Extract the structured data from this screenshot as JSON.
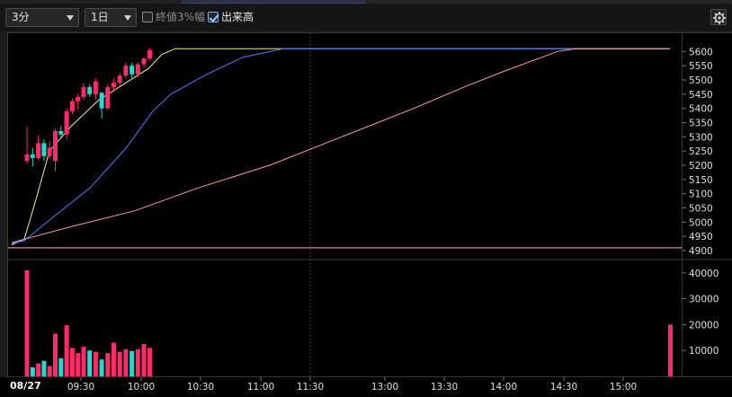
{
  "toolbar": {
    "interval_select": "3分",
    "period_select": "1日",
    "closing_range_label": "終値3%幅",
    "closing_range_checked": false,
    "volume_label": "出来高",
    "volume_checked": true,
    "settings_icon": "gear-icon"
  },
  "chart": {
    "date_label": "08/27",
    "time_ticks": [
      "09:30",
      "10:00",
      "10:30",
      "11:00",
      "11:30",
      "13:00",
      "13:30",
      "14:00",
      "14:30",
      "15:00"
    ],
    "price_ticks": [
      "5600",
      "5550",
      "5500",
      "5450",
      "5400",
      "5350",
      "5300",
      "5250",
      "5200",
      "5150",
      "5100",
      "5050",
      "5000",
      "4950",
      "4900"
    ],
    "volume_ticks": [
      "40000",
      "30000",
      "20000",
      "10000"
    ],
    "colors": {
      "up_candle": "#ff2a6a",
      "down_candle": "#22d8d0",
      "ma_short": "#f4f08a",
      "ma_mid": "#4f7cff",
      "ma_long": "#ff9aa8",
      "reference_line": "#ffb0b0"
    }
  },
  "chart_data": {
    "type": "candlestick",
    "candles": [
      {
        "time": "09:00",
        "open": 5215,
        "high": 5335,
        "low": 5205,
        "close": 5238
      },
      {
        "time": "09:03",
        "open": 5238,
        "high": 5262,
        "low": 5196,
        "close": 5225
      },
      {
        "time": "09:06",
        "open": 5225,
        "high": 5305,
        "low": 5220,
        "close": 5278
      },
      {
        "time": "09:09",
        "open": 5278,
        "high": 5290,
        "low": 5215,
        "close": 5232
      },
      {
        "time": "09:12",
        "open": 5232,
        "high": 5285,
        "low": 5222,
        "close": 5262
      },
      {
        "time": "09:15",
        "open": 5215,
        "high": 5330,
        "low": 5178,
        "close": 5320
      },
      {
        "time": "09:18",
        "open": 5320,
        "high": 5338,
        "low": 5298,
        "close": 5308
      },
      {
        "time": "09:21",
        "open": 5308,
        "high": 5400,
        "low": 5290,
        "close": 5390
      },
      {
        "time": "09:24",
        "open": 5390,
        "high": 5435,
        "low": 5380,
        "close": 5425
      },
      {
        "time": "09:27",
        "open": 5425,
        "high": 5450,
        "low": 5395,
        "close": 5440
      },
      {
        "time": "09:30",
        "open": 5440,
        "high": 5490,
        "low": 5430,
        "close": 5475
      },
      {
        "time": "09:33",
        "open": 5475,
        "high": 5485,
        "low": 5440,
        "close": 5450
      },
      {
        "time": "09:36",
        "open": 5450,
        "high": 5505,
        "low": 5430,
        "close": 5495
      },
      {
        "time": "09:39",
        "open": 5455,
        "high": 5458,
        "low": 5365,
        "close": 5400
      },
      {
        "time": "09:42",
        "open": 5400,
        "high": 5485,
        "low": 5395,
        "close": 5475
      },
      {
        "time": "09:45",
        "open": 5475,
        "high": 5505,
        "low": 5458,
        "close": 5490
      },
      {
        "time": "09:48",
        "open": 5490,
        "high": 5525,
        "low": 5478,
        "close": 5515
      },
      {
        "time": "09:51",
        "open": 5515,
        "high": 5560,
        "low": 5505,
        "close": 5550
      },
      {
        "time": "09:54",
        "open": 5550,
        "high": 5560,
        "low": 5508,
        "close": 5520
      },
      {
        "time": "09:57",
        "open": 5520,
        "high": 5562,
        "low": 5510,
        "close": 5555
      },
      {
        "time": "10:00",
        "open": 5555,
        "high": 5580,
        "low": 5545,
        "close": 5575
      },
      {
        "time": "10:03",
        "open": 5575,
        "high": 5612,
        "low": 5570,
        "close": 5605
      }
    ],
    "volume": [
      41000,
      3500,
      5000,
      6000,
      4000,
      16500,
      7000,
      19800,
      11000,
      9000,
      11500,
      10000,
      9500,
      6500,
      9000,
      13000,
      9500,
      10500,
      9800,
      10500,
      12500,
      11000
    ],
    "volume_last": 20000,
    "ylim": [
      4900,
      5620
    ],
    "volume_ylim": [
      0,
      42000
    ],
    "x_range": [
      "09:00",
      "15:30"
    ],
    "moving_averages": [
      {
        "values": [
          4920,
          5200,
          5420,
          5600,
          5610,
          5610,
          5610,
          5610
        ]
      },
      {
        "values": [
          4925,
          5050,
          5250,
          5450,
          5550,
          5610,
          5610,
          5610
        ]
      },
      {
        "values": [
          4930,
          5000,
          5100,
          5210,
          5340,
          5470,
          5570,
          5610
        ]
      }
    ]
  }
}
